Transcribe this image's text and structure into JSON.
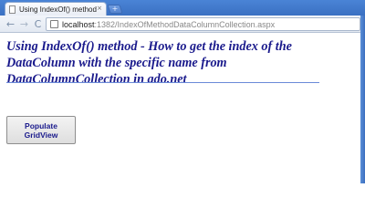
{
  "browser": {
    "tab_title": "Using IndexOf() method ...",
    "tab_close": "×",
    "new_tab": "+",
    "url_host": "localhost",
    "url_path": ":1382/IndexOfMethodDataColumnCollection.aspx",
    "nav_back": "←",
    "nav_forward": "→",
    "nav_reload": "C"
  },
  "page": {
    "title": "Using IndexOf() method - How to get the index of the DataColumn with the specific name from DataColumnCollection in ado.net",
    "button_label": "Populate GridView"
  }
}
